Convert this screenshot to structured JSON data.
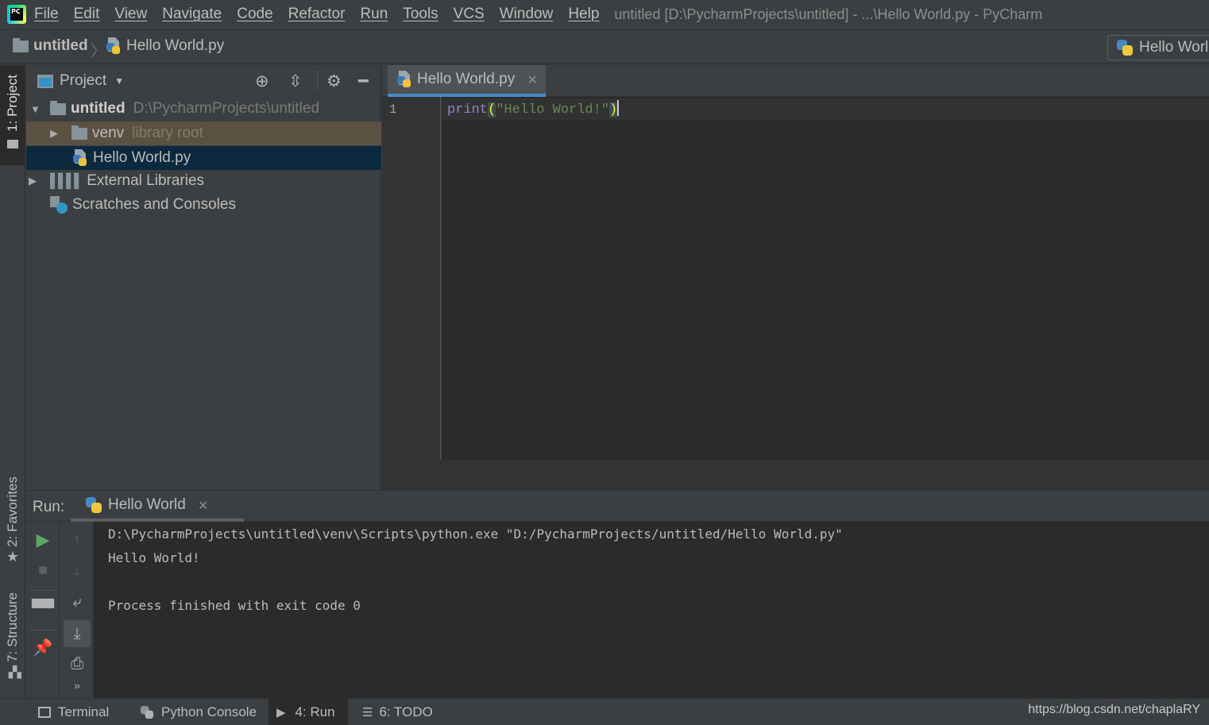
{
  "menu": {
    "items": [
      "File",
      "Edit",
      "View",
      "Navigate",
      "Code",
      "Refactor",
      "Run",
      "Tools",
      "VCS",
      "Window",
      "Help"
    ],
    "window_title": "untitled [D:\\PycharmProjects\\untitled] - ...\\Hello World.py - PyCharm",
    "logo_text": "PC"
  },
  "navbar": {
    "project_crumb": "untitled",
    "file_crumb": "Hello World.py",
    "run_config": "Hello World"
  },
  "left_stripe": {
    "project_tab": "1: Project",
    "favorites_tab": "2: Favorites",
    "structure_tab": "7: Structure"
  },
  "project_panel": {
    "title": "Project",
    "tree": {
      "root_name": "untitled",
      "root_path": "D:\\PycharmProjects\\untitled",
      "venv_name": "venv",
      "venv_note": "library root",
      "file_name": "Hello World.py",
      "ext_libs": "External Libraries",
      "scratches": "Scratches and Consoles"
    }
  },
  "editor": {
    "tab_label": "Hello World.py",
    "line_number": "1",
    "code": {
      "keyword": "print",
      "open_paren": "(",
      "string": "\"Hello World!\"",
      "close_paren": ")"
    }
  },
  "run_panel": {
    "label": "Run:",
    "tab_label": "Hello World",
    "console_lines": {
      "cmd": "D:\\PycharmProjects\\untitled\\venv\\Scripts\\python.exe \"D:/PycharmProjects/untitled/Hello World.py\"",
      "output": "Hello World!",
      "exit": "Process finished with exit code 0"
    }
  },
  "statusbar": {
    "terminal": "Terminal",
    "python_console": "Python Console",
    "run": "4: Run",
    "todo": "6: TODO",
    "watermark": "https://blog.csdn.net/chaplaRY"
  },
  "colors": {
    "accent": "#4a88c7",
    "selection": "#0d293e",
    "venv_highlight": "#5a5143",
    "run_green": "#59a869",
    "keyword": "#8888c6",
    "string": "#6a8759"
  },
  "icons": [
    "pycharm-logo-icon",
    "folder-icon",
    "python-file-icon",
    "python-logo-icon",
    "locate-icon",
    "collapse-icon",
    "gear-icon",
    "hide-icon",
    "play-icon",
    "stop-icon",
    "up-arrow-icon",
    "down-arrow-icon",
    "layout-icon",
    "soft-wrap-icon",
    "scroll-to-end-icon",
    "pin-icon",
    "print-icon",
    "more-icon",
    "star-icon",
    "structure-icon",
    "terminal-icon",
    "todo-icon",
    "libraries-icon",
    "scratches-icon"
  ]
}
